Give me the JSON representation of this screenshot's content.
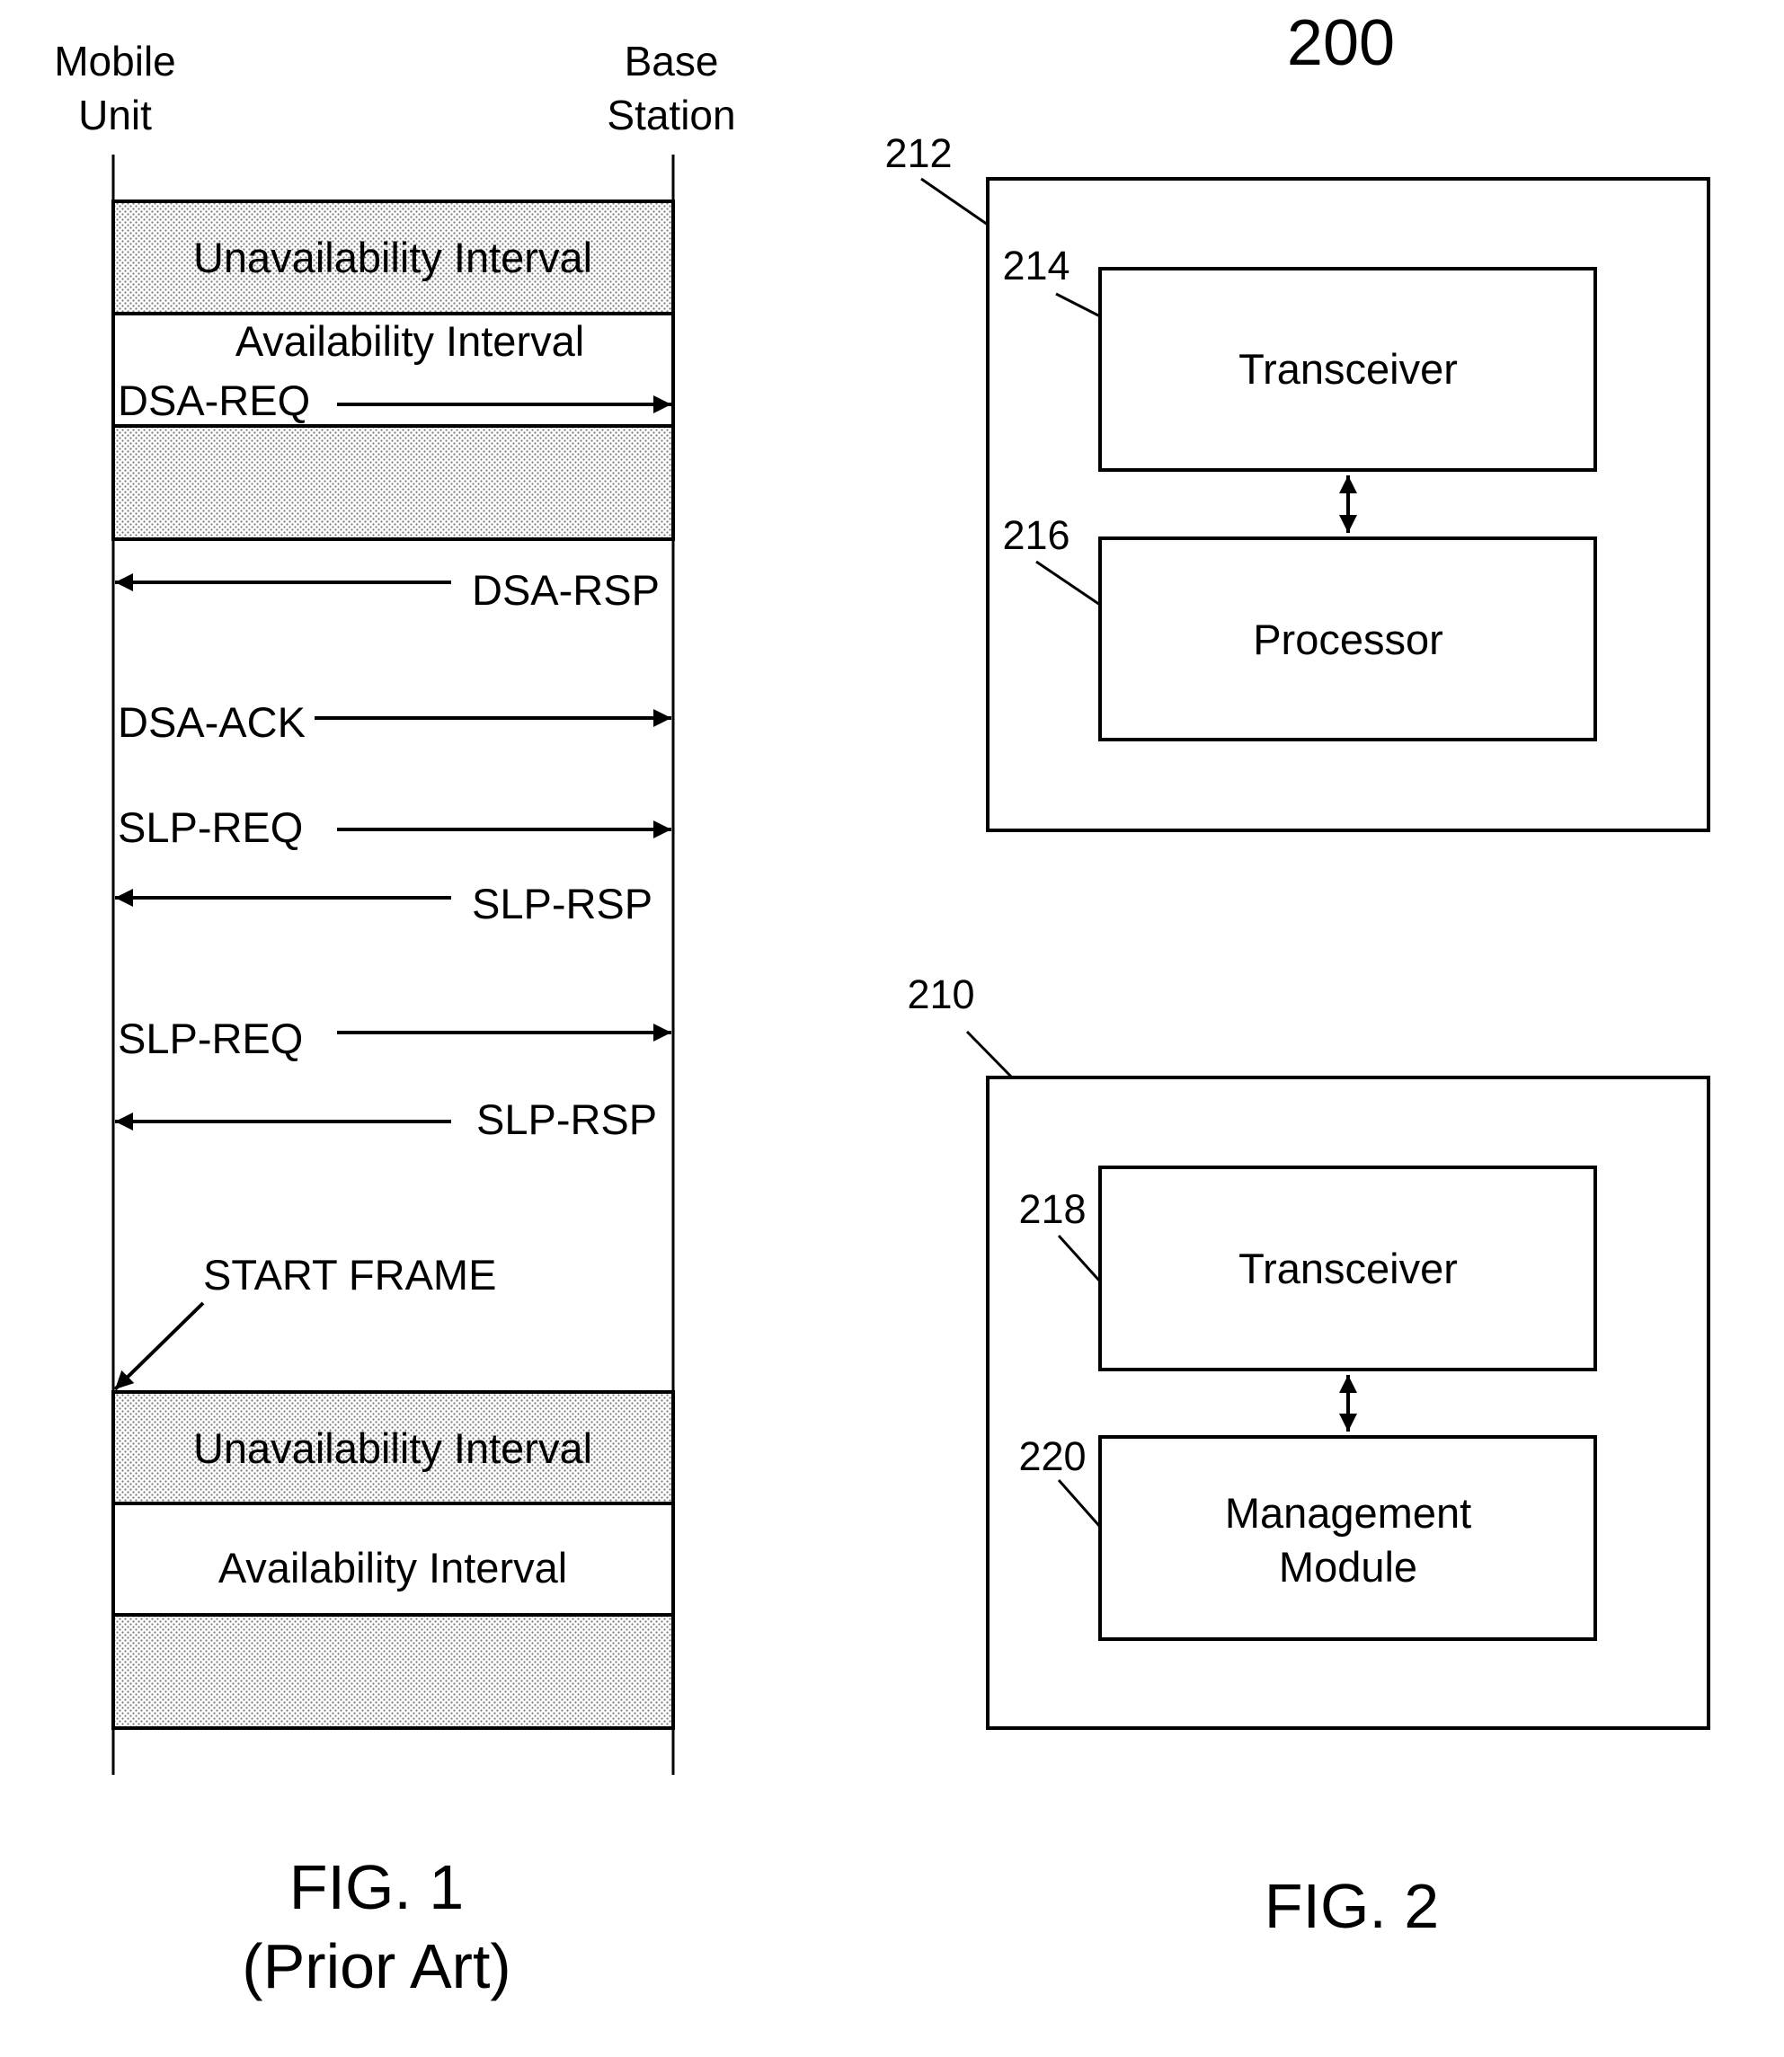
{
  "fig1": {
    "entities": {
      "left": "Mobile Unit",
      "left_line1": "Mobile",
      "left_line2": "Unit",
      "right_line1": "Base",
      "right_line2": "Station"
    },
    "intervals": [
      {
        "kind": "unavailable",
        "label": "Unavailability Interval"
      },
      {
        "kind": "available",
        "label": "Availability Interval"
      },
      {
        "kind": "unavailable",
        "label": ""
      },
      {
        "kind": "unavailable",
        "label": "Unavailability Interval"
      },
      {
        "kind": "available",
        "label": "Availability Interval"
      },
      {
        "kind": "unavailable",
        "label": ""
      }
    ],
    "messages": [
      {
        "label": "DSA-REQ",
        "direction": "to-base"
      },
      {
        "label": "DSA-RSP",
        "direction": "to-mobile"
      },
      {
        "label": "DSA-ACK",
        "direction": "to-base"
      },
      {
        "label": "SLP-REQ",
        "direction": "to-base"
      },
      {
        "label": "SLP-RSP",
        "direction": "to-mobile"
      },
      {
        "label": "SLP-REQ",
        "direction": "to-base"
      },
      {
        "label": "SLP-RSP",
        "direction": "to-mobile"
      }
    ],
    "start_frame": "START FRAME",
    "caption_line1": "FIG. 1",
    "caption_line2": "(Prior Art)"
  },
  "fig2": {
    "system_ref": "200",
    "devices": [
      {
        "ref": "212",
        "components": [
          {
            "ref": "214",
            "label": "Transceiver"
          },
          {
            "ref": "216",
            "label": "Processor"
          }
        ]
      },
      {
        "ref": "210",
        "components": [
          {
            "ref": "218",
            "label": "Transceiver"
          },
          {
            "ref": "220",
            "label_line1": "Management",
            "label_line2": "Module"
          }
        ]
      }
    ],
    "caption": "FIG. 2"
  },
  "colors": {
    "ink": "#000000",
    "paper": "#ffffff",
    "stipple": "#c8c8c8"
  }
}
